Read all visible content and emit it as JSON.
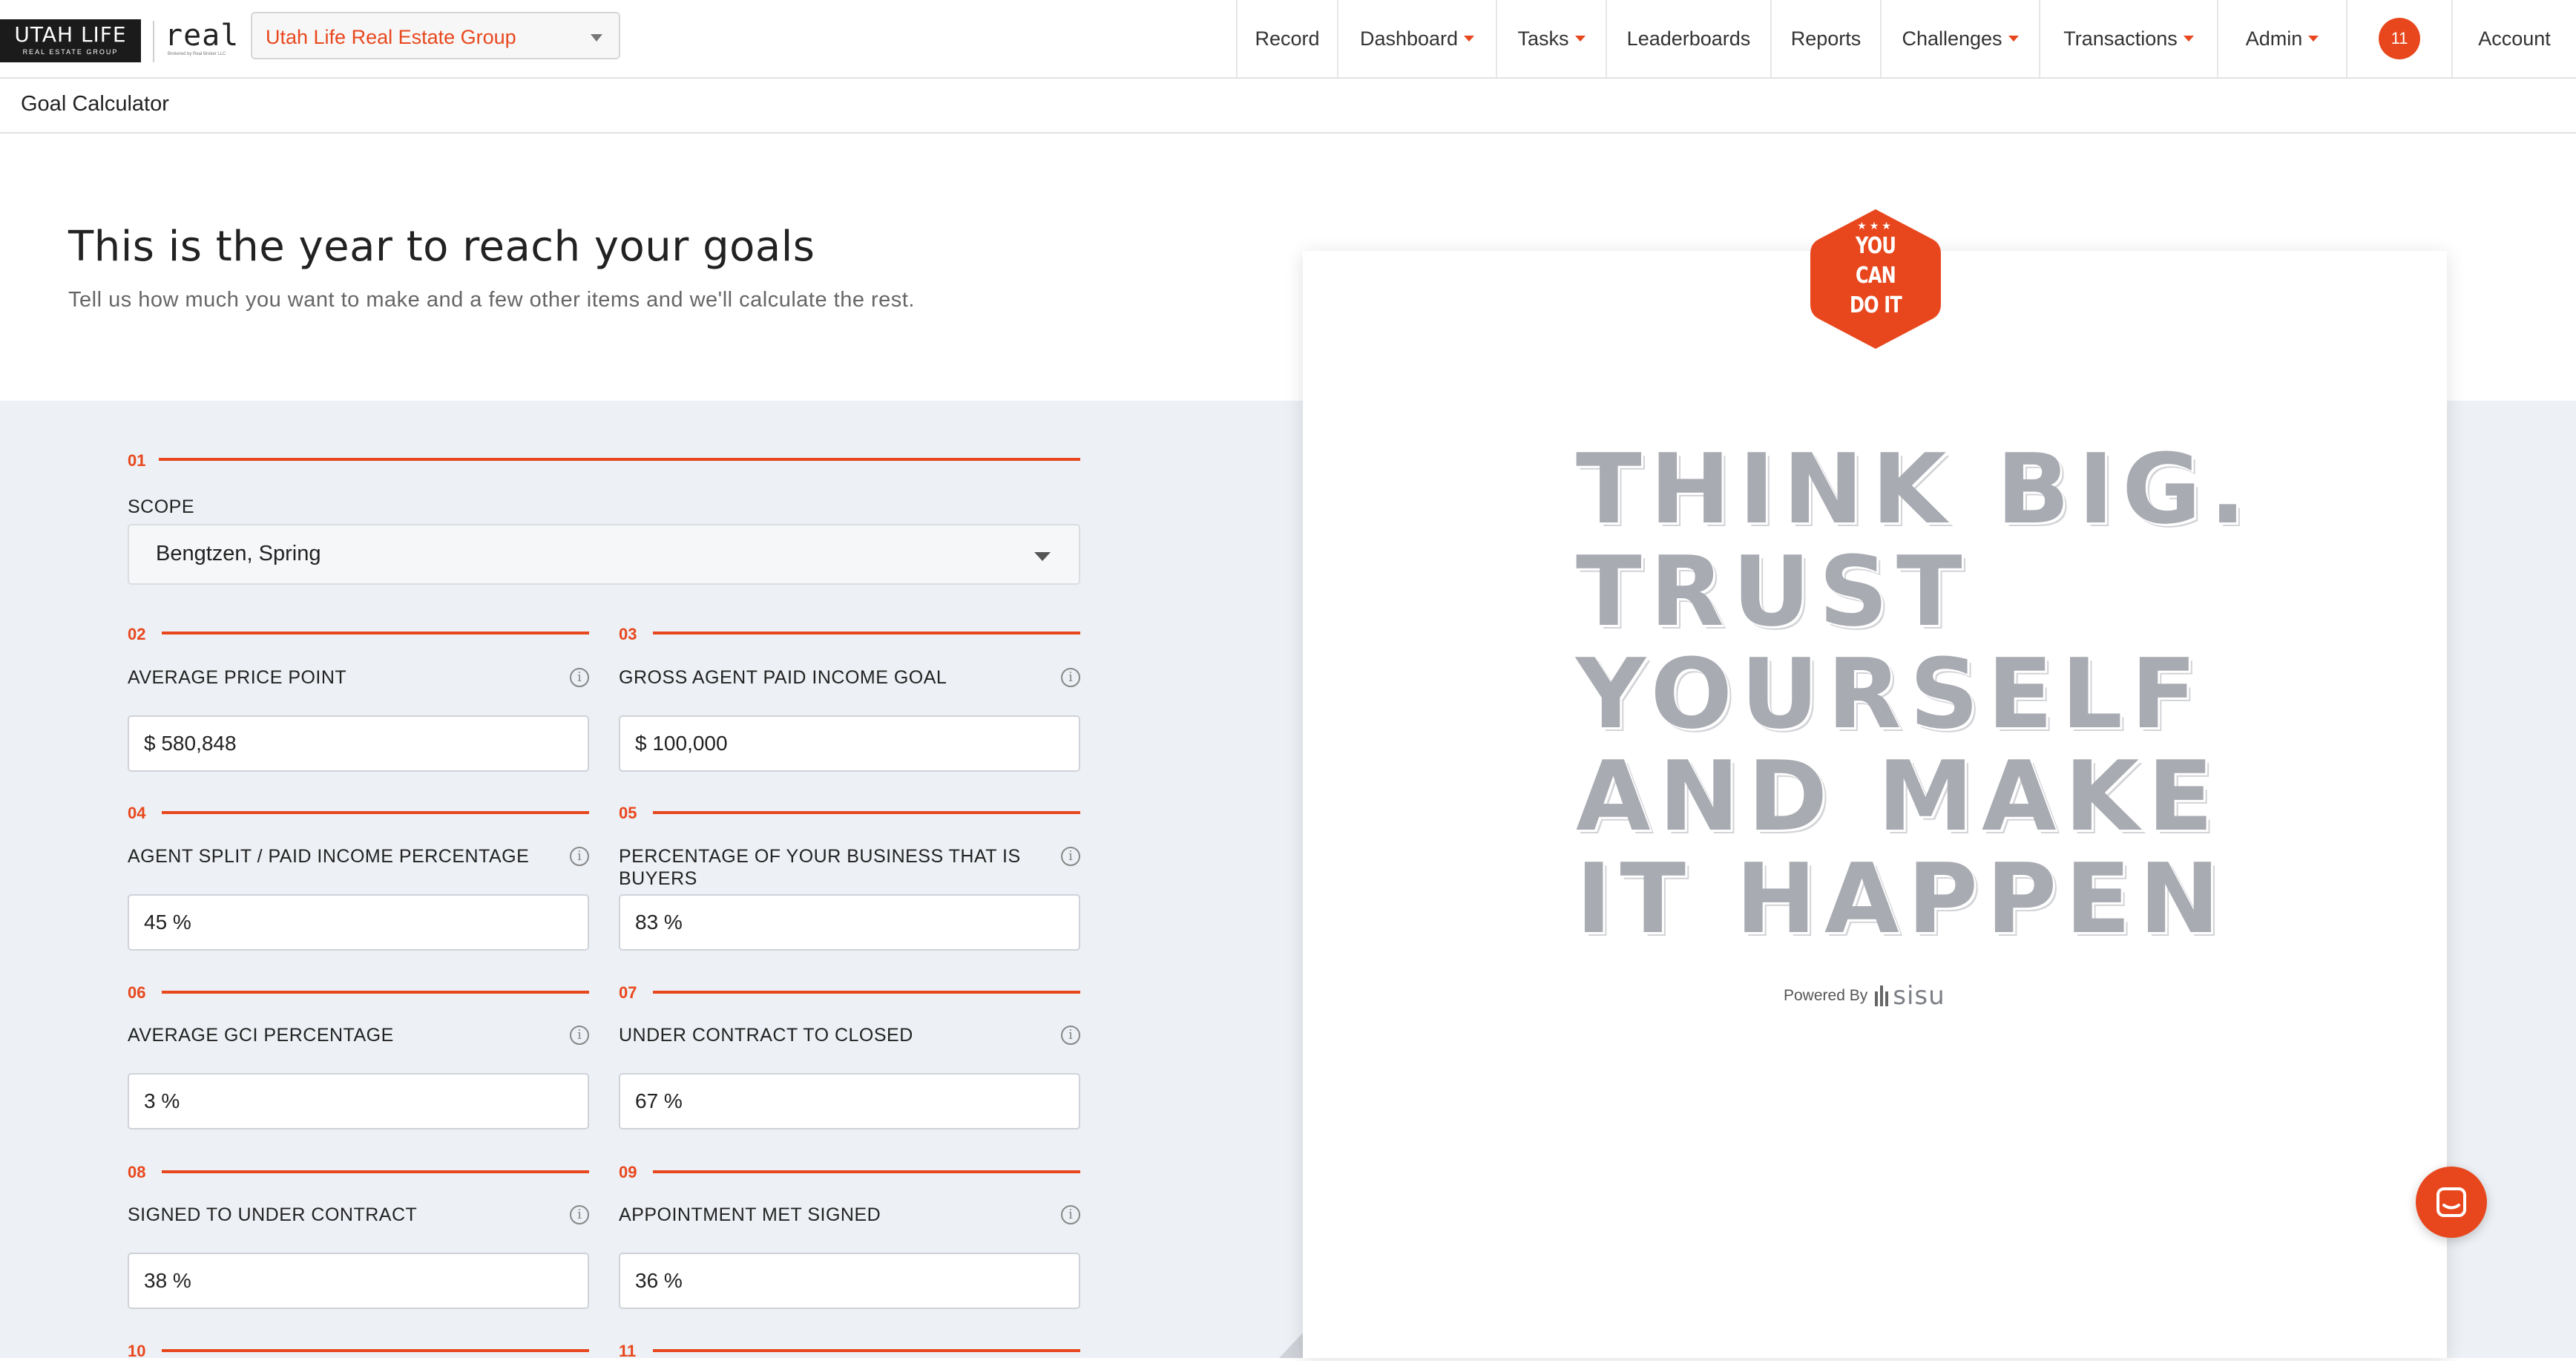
{
  "brand": {
    "logo_main": "UTAH LIFE",
    "logo_sub": "REAL ESTATE GROUP",
    "partner_logo": "real",
    "partner_sub": "Brokered by Real Broker LLC"
  },
  "team_select": {
    "value": "Utah Life Real Estate Group"
  },
  "nav": {
    "items": [
      {
        "label": "Record",
        "dropdown": false
      },
      {
        "label": "Dashboard",
        "dropdown": true
      },
      {
        "label": "Tasks",
        "dropdown": true
      },
      {
        "label": "Leaderboards",
        "dropdown": false
      },
      {
        "label": "Reports",
        "dropdown": false
      },
      {
        "label": "Challenges",
        "dropdown": true
      },
      {
        "label": "Transactions",
        "dropdown": true
      },
      {
        "label": "Admin",
        "dropdown": true
      }
    ],
    "notification_count": "11",
    "account_label": "Account"
  },
  "page": {
    "title": "Goal Calculator"
  },
  "intro": {
    "heading": "This is the year to reach your goals",
    "subheading": "Tell us how much you want to make and a few other items and we'll calculate the rest."
  },
  "form": {
    "scope": {
      "number": "01",
      "label": "SCOPE",
      "value": "Bengtzen, Spring"
    },
    "fields": [
      {
        "number": "02",
        "label": "AVERAGE PRICE POINT",
        "value": "$ 580,848"
      },
      {
        "number": "03",
        "label": "GROSS AGENT PAID INCOME GOAL",
        "value": "$ 100,000"
      },
      {
        "number": "04",
        "label": "AGENT SPLIT / PAID INCOME PERCENTAGE",
        "value": "45 %"
      },
      {
        "number": "05",
        "label": "PERCENTAGE OF YOUR BUSINESS THAT IS BUYERS",
        "value": "83 %"
      },
      {
        "number": "06",
        "label": "AVERAGE GCI PERCENTAGE",
        "value": "3 %"
      },
      {
        "number": "07",
        "label": "UNDER CONTRACT TO CLOSED",
        "value": "67 %"
      },
      {
        "number": "08",
        "label": "SIGNED TO UNDER CONTRACT",
        "value": "38 %"
      },
      {
        "number": "09",
        "label": "APPOINTMENT MET SIGNED",
        "value": "36 %"
      }
    ],
    "next_numbers": [
      "10",
      "11"
    ]
  },
  "poster": {
    "badge_lines": [
      "YOU",
      "CAN",
      "DO IT"
    ],
    "lines": [
      "THINK BIG.",
      "TRUST",
      "YOURSELF",
      "AND MAKE",
      "IT HAPPEN"
    ],
    "powered_by": "Powered By",
    "powered_brand": "sisu"
  },
  "colors": {
    "accent": "#e8471d",
    "panel_bg": "#edf0f4",
    "poster_text": "#a9abb2"
  }
}
